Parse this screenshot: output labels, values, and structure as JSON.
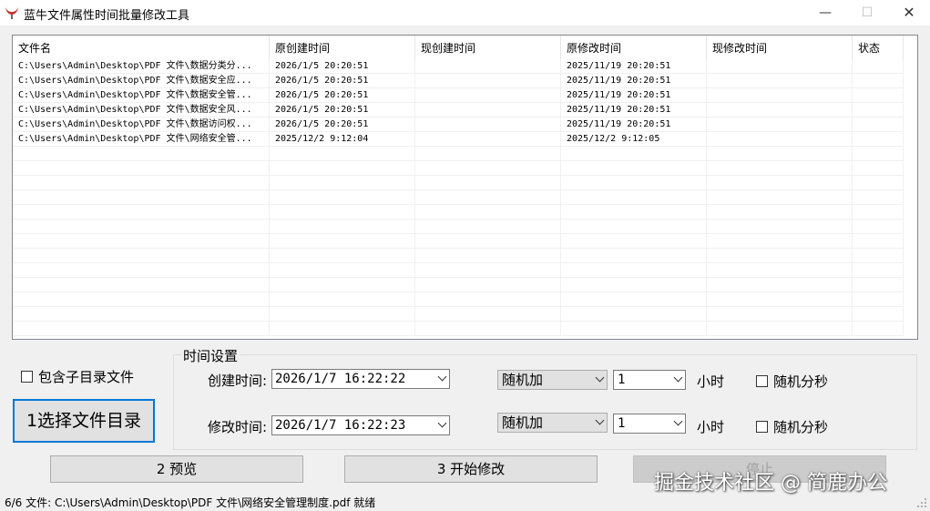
{
  "window": {
    "title": "蓝牛文件属性时间批量修改工具",
    "min_glyph": "—",
    "max_glyph": "☐",
    "close_glyph": "✕",
    "icon": "bull-horns-icon",
    "accent_color": "#0078d7"
  },
  "list": {
    "columns": [
      "文件名",
      "原创建时间",
      "现创建时间",
      "原修改时间",
      "现修改时间",
      "状态"
    ],
    "rows": [
      [
        "C:\\Users\\Admin\\Desktop\\PDF 文件\\数据分类分...",
        "2026/1/5 20:20:51",
        "",
        "2025/11/19 20:20:51",
        "",
        ""
      ],
      [
        "C:\\Users\\Admin\\Desktop\\PDF 文件\\数据安全应...",
        "2026/1/5 20:20:51",
        "",
        "2025/11/19 20:20:51",
        "",
        ""
      ],
      [
        "C:\\Users\\Admin\\Desktop\\PDF 文件\\数据安全管...",
        "2026/1/5 20:20:51",
        "",
        "2025/11/19 20:20:51",
        "",
        ""
      ],
      [
        "C:\\Users\\Admin\\Desktop\\PDF 文件\\数据安全风...",
        "2026/1/5 20:20:51",
        "",
        "2025/11/19 20:20:51",
        "",
        ""
      ],
      [
        "C:\\Users\\Admin\\Desktop\\PDF 文件\\数据访问权...",
        "2026/1/5 20:20:51",
        "",
        "2025/11/19 20:20:51",
        "",
        ""
      ],
      [
        "C:\\Users\\Admin\\Desktop\\PDF 文件\\网络安全管...",
        "2025/12/2 9:12:04",
        "",
        "2025/12/2 9:12:05",
        "",
        ""
      ]
    ]
  },
  "options": {
    "include_subdirs_label": "包含子目录文件",
    "include_subdirs_checked": false
  },
  "time_settings": {
    "legend": "时间设置",
    "create_label": "创建时间:",
    "create_value": "2026/1/7 16:22:22",
    "create_mode": "随机加",
    "create_amount": "1",
    "create_unit": "小时",
    "create_random_label": "随机分秒",
    "modify_label": "修改时间:",
    "modify_value": "2026/1/7 16:22:23",
    "modify_mode": "随机加",
    "modify_amount": "1",
    "modify_unit": "小时",
    "modify_random_label": "随机分秒"
  },
  "buttons": {
    "select_dir": "1选择文件目录",
    "preview": "2 预览",
    "start": "3 开始修改",
    "stop": "停止"
  },
  "status": {
    "text": "6/6 文件: C:\\Users\\Admin\\Desktop\\PDF 文件\\网络安全管理制度.pdf  就绪"
  },
  "watermark": "掘金技术社区 @ 简鹿办公"
}
